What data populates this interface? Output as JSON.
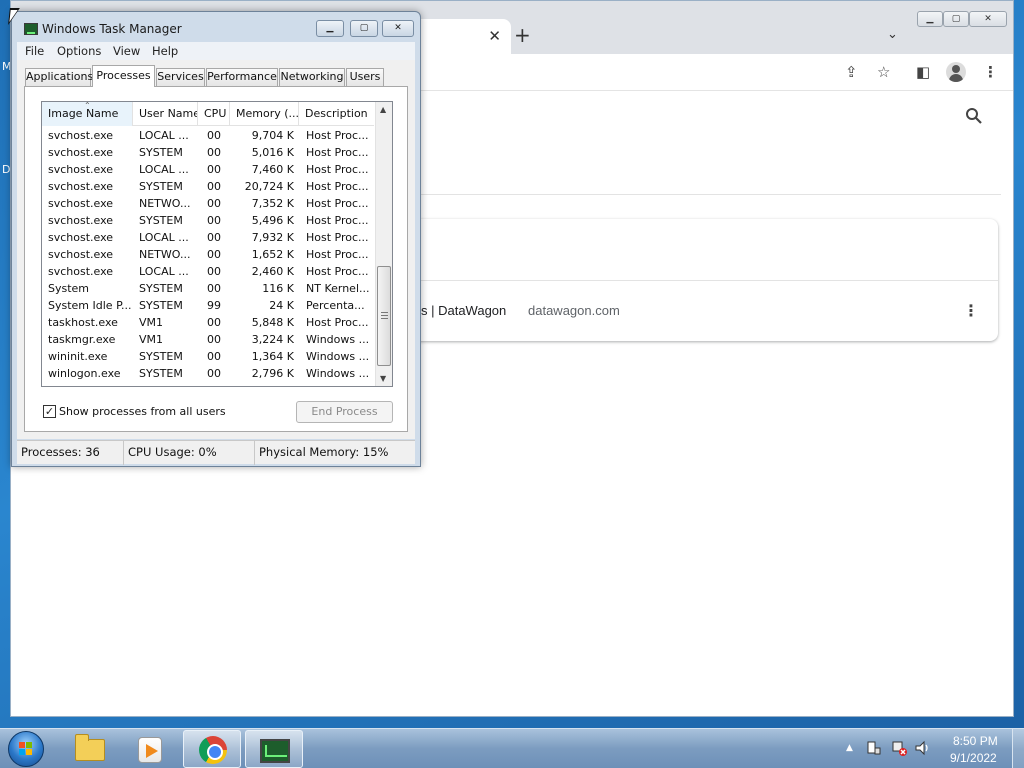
{
  "desktop": {
    "edge_letter_top": "M",
    "edge_letter_mid": "D"
  },
  "chrome": {
    "tab_close": "✕",
    "new_tab": "+",
    "tab_search": "⌄",
    "caption": {
      "minimize": "▁",
      "maximize": "▢",
      "close": "✕"
    },
    "toolbar": {
      "share": "⇪",
      "bookmark": "☆",
      "side_panel": "◧",
      "menu": "⋮"
    },
    "result": {
      "title": "s | DataWagon",
      "url": "datawagon.com",
      "menu": "⋮"
    }
  },
  "task_manager": {
    "title": "Windows Task Manager",
    "caption": {
      "minimize": "▁",
      "maximize": "▢",
      "close": "✕"
    },
    "menu": [
      "File",
      "Options",
      "View",
      "Help"
    ],
    "tabs": [
      "Applications",
      "Processes",
      "Services",
      "Performance",
      "Networking",
      "Users"
    ],
    "active_tab": "Processes",
    "columns": [
      "Image Name",
      "User Name",
      "CPU",
      "Memory (...",
      "Description"
    ],
    "rows": [
      [
        "svchost.exe",
        "LOCAL ...",
        "00",
        "9,704 K",
        "Host Proc..."
      ],
      [
        "svchost.exe",
        "SYSTEM",
        "00",
        "5,016 K",
        "Host Proc..."
      ],
      [
        "svchost.exe",
        "LOCAL ...",
        "00",
        "7,460 K",
        "Host Proc..."
      ],
      [
        "svchost.exe",
        "SYSTEM",
        "00",
        "20,724 K",
        "Host Proc..."
      ],
      [
        "svchost.exe",
        "NETWO...",
        "00",
        "7,352 K",
        "Host Proc..."
      ],
      [
        "svchost.exe",
        "SYSTEM",
        "00",
        "5,496 K",
        "Host Proc..."
      ],
      [
        "svchost.exe",
        "LOCAL ...",
        "00",
        "7,932 K",
        "Host Proc..."
      ],
      [
        "svchost.exe",
        "NETWO...",
        "00",
        "1,652 K",
        "Host Proc..."
      ],
      [
        "svchost.exe",
        "LOCAL ...",
        "00",
        "2,460 K",
        "Host Proc..."
      ],
      [
        "System",
        "SYSTEM",
        "00",
        "116 K",
        "NT Kernel..."
      ],
      [
        "System Idle P...",
        "SYSTEM",
        "99",
        "24 K",
        "Percenta..."
      ],
      [
        "taskhost.exe",
        "VM1",
        "00",
        "5,848 K",
        "Host Proc..."
      ],
      [
        "taskmgr.exe",
        "VM1",
        "00",
        "3,224 K",
        "Windows ..."
      ],
      [
        "wininit.exe",
        "SYSTEM",
        "00",
        "1,364 K",
        "Windows ..."
      ],
      [
        "winlogon.exe",
        "SYSTEM",
        "00",
        "2,796 K",
        "Windows ..."
      ]
    ],
    "show_all_users_label": "Show processes from all users",
    "show_all_users_checked": true,
    "check_mark": "✓",
    "end_process_label": "End Process",
    "status": {
      "processes": "Processes: 36",
      "cpu": "CPU Usage: 0%",
      "memory": "Physical Memory: 15%"
    }
  },
  "taskbar": {
    "apps": [
      "explorer-folder",
      "media-player",
      "chrome",
      "task-manager"
    ],
    "tray_arrow": "▲",
    "clock_time": "8:50 PM",
    "clock_date": "9/1/2022"
  }
}
